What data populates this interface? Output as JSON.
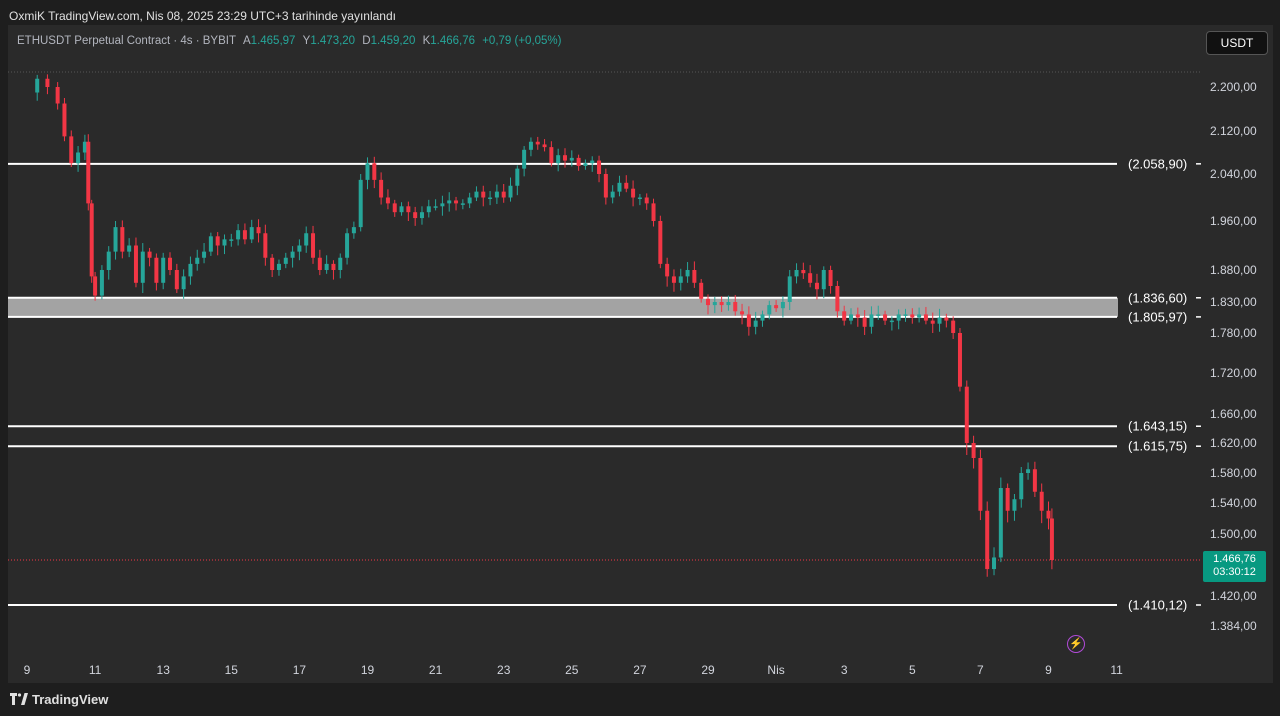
{
  "header": {
    "title": "OxmiK TradingView.com, Nis 08, 2025 23:29 UTC+3 tarihinde yayınlandı"
  },
  "symbol_bar": {
    "name": "ETHUSDT Perpetual Contract · 4s · BYBIT",
    "open_label": "A",
    "open": "1.465,97",
    "high_label": "Y",
    "high": "1.473,20",
    "low_label": "D",
    "low": "1.459,20",
    "close_label": "K",
    "close": "1.466,76",
    "change": "+0,79 (+0,05%)"
  },
  "currency_button": "USDT",
  "last_price": {
    "value": "1.466,76",
    "countdown": "03:30:12",
    "raw": 1466.76
  },
  "footer": {
    "logo_text": "TradingView"
  },
  "icons": {
    "bolt": "lightning-bolt-icon",
    "logo": "tradingview-logo-icon"
  },
  "colors": {
    "up": "#26a69a",
    "down": "#f23645",
    "background": "#2a2a2a",
    "level": "#ffffff",
    "zone": "#b2b2b2",
    "tag": "#089981"
  },
  "chart_data": {
    "type": "candlestick",
    "title": "ETHUSDT Perpetual Contract · 4s · BYBIT",
    "x_ticks": [
      "9",
      "11",
      "13",
      "15",
      "17",
      "19",
      "21",
      "23",
      "25",
      "27",
      "29",
      "Nis",
      "3",
      "5",
      "7",
      "9",
      "11"
    ],
    "y_ticks": [
      {
        "value": 2200,
        "label": "2.200,00"
      },
      {
        "value": 2120,
        "label": "2.120,00"
      },
      {
        "value": 2040,
        "label": "2.040,00"
      },
      {
        "value": 1960,
        "label": "1.960,00"
      },
      {
        "value": 1880,
        "label": "1.880,00"
      },
      {
        "value": 1830,
        "label": "1.830,00"
      },
      {
        "value": 1780,
        "label": "1.780,00"
      },
      {
        "value": 1720,
        "label": "1.720,00"
      },
      {
        "value": 1660,
        "label": "1.660,00"
      },
      {
        "value": 1620,
        "label": "1.620,00"
      },
      {
        "value": 1580,
        "label": "1.580,00"
      },
      {
        "value": 1540,
        "label": "1.540,00"
      },
      {
        "value": 1500,
        "label": "1.500,00"
      },
      {
        "value": 1420,
        "label": "1.420,00"
      },
      {
        "value": 1384,
        "label": "1.384,00"
      }
    ],
    "levels": [
      {
        "value": 2058.9,
        "label": "(2.058,90)"
      },
      {
        "value": 1836.6,
        "label": "(1.836,60)"
      },
      {
        "value": 1805.97,
        "label": "(1.805,97)"
      },
      {
        "value": 1643.15,
        "label": "(1.643,15)"
      },
      {
        "value": 1615.75,
        "label": "(1.615,75)"
      },
      {
        "value": 1410.12,
        "label": "(1.410,12)"
      }
    ],
    "zone": {
      "low": 1805.97,
      "high": 1836.6
    },
    "series_close": [
      [
        9.0,
        2190
      ],
      [
        9.3,
        2215
      ],
      [
        9.6,
        2200
      ],
      [
        9.9,
        2170
      ],
      [
        10.1,
        2110
      ],
      [
        10.3,
        2060
      ],
      [
        10.5,
        2080
      ],
      [
        10.7,
        2100
      ],
      [
        10.8,
        1990
      ],
      [
        10.9,
        1870
      ],
      [
        11.0,
        1840
      ],
      [
        11.2,
        1880
      ],
      [
        11.4,
        1910
      ],
      [
        11.6,
        1950
      ],
      [
        11.8,
        1910
      ],
      [
        12.0,
        1920
      ],
      [
        12.2,
        1860
      ],
      [
        12.4,
        1910
      ],
      [
        12.6,
        1900
      ],
      [
        12.8,
        1860
      ],
      [
        13.0,
        1900
      ],
      [
        13.2,
        1880
      ],
      [
        13.4,
        1850
      ],
      [
        13.6,
        1870
      ],
      [
        13.8,
        1890
      ],
      [
        14.0,
        1900
      ],
      [
        14.2,
        1910
      ],
      [
        14.4,
        1935
      ],
      [
        14.6,
        1920
      ],
      [
        14.8,
        1930
      ],
      [
        15.0,
        1930
      ],
      [
        15.2,
        1945
      ],
      [
        15.4,
        1930
      ],
      [
        15.6,
        1950
      ],
      [
        15.8,
        1940
      ],
      [
        16.0,
        1900
      ],
      [
        16.2,
        1880
      ],
      [
        16.4,
        1890
      ],
      [
        16.6,
        1900
      ],
      [
        16.8,
        1910
      ],
      [
        17.0,
        1920
      ],
      [
        17.2,
        1940
      ],
      [
        17.4,
        1900
      ],
      [
        17.6,
        1880
      ],
      [
        17.8,
        1890
      ],
      [
        18.0,
        1880
      ],
      [
        18.2,
        1900
      ],
      [
        18.4,
        1940
      ],
      [
        18.6,
        1950
      ],
      [
        18.8,
        2030
      ],
      [
        19.0,
        2060
      ],
      [
        19.2,
        2030
      ],
      [
        19.4,
        2000
      ],
      [
        19.6,
        1990
      ],
      [
        19.8,
        1975
      ],
      [
        20.0,
        1985
      ],
      [
        20.2,
        1975
      ],
      [
        20.4,
        1965
      ],
      [
        20.6,
        1975
      ],
      [
        20.8,
        1985
      ],
      [
        21.0,
        1985
      ],
      [
        21.2,
        1990
      ],
      [
        21.4,
        1995
      ],
      [
        21.6,
        1990
      ],
      [
        21.8,
        1990
      ],
      [
        22.0,
        2000
      ],
      [
        22.2,
        2010
      ],
      [
        22.4,
        2000
      ],
      [
        22.6,
        2000
      ],
      [
        22.8,
        2010
      ],
      [
        23.0,
        2000
      ],
      [
        23.2,
        2020
      ],
      [
        23.4,
        2050
      ],
      [
        23.6,
        2085
      ],
      [
        23.8,
        2100
      ],
      [
        24.0,
        2095
      ],
      [
        24.2,
        2090
      ],
      [
        24.4,
        2060
      ],
      [
        24.6,
        2075
      ],
      [
        24.8,
        2065
      ],
      [
        25.0,
        2070
      ],
      [
        25.2,
        2055
      ],
      [
        25.4,
        2060
      ],
      [
        25.6,
        2065
      ],
      [
        25.8,
        2040
      ],
      [
        26.0,
        2000
      ],
      [
        26.2,
        2010
      ],
      [
        26.4,
        2025
      ],
      [
        26.6,
        2015
      ],
      [
        26.8,
        2000
      ],
      [
        27.0,
        2000
      ],
      [
        27.2,
        1990
      ],
      [
        27.4,
        1960
      ],
      [
        27.6,
        1890
      ],
      [
        27.8,
        1870
      ],
      [
        28.0,
        1860
      ],
      [
        28.2,
        1870
      ],
      [
        28.4,
        1880
      ],
      [
        28.6,
        1860
      ],
      [
        28.8,
        1835
      ],
      [
        29.0,
        1825
      ],
      [
        29.2,
        1830
      ],
      [
        29.4,
        1825
      ],
      [
        29.6,
        1830
      ],
      [
        29.8,
        1815
      ],
      [
        30.0,
        1810
      ],
      [
        30.2,
        1790
      ],
      [
        30.4,
        1800
      ],
      [
        30.6,
        1810
      ],
      [
        30.8,
        1825
      ],
      [
        31.0,
        1820
      ],
      [
        31.2,
        1830
      ],
      [
        31.4,
        1870
      ],
      [
        31.6,
        1880
      ],
      [
        31.8,
        1875
      ],
      [
        32.0,
        1860
      ],
      [
        32.2,
        1850
      ],
      [
        32.4,
        1880
      ],
      [
        32.6,
        1855
      ],
      [
        32.8,
        1815
      ],
      [
        33.0,
        1800
      ],
      [
        33.2,
        1810
      ],
      [
        33.4,
        1805
      ],
      [
        33.6,
        1790
      ],
      [
        33.8,
        1810
      ],
      [
        34.0,
        1810
      ],
      [
        34.2,
        1800
      ],
      [
        34.4,
        1800
      ],
      [
        34.6,
        1810
      ],
      [
        34.8,
        1810
      ],
      [
        35.0,
        1805
      ],
      [
        35.2,
        1810
      ],
      [
        35.4,
        1800
      ],
      [
        35.6,
        1795
      ],
      [
        35.8,
        1805
      ],
      [
        36.0,
        1800
      ],
      [
        36.2,
        1780
      ],
      [
        36.4,
        1700
      ],
      [
        36.6,
        1620
      ],
      [
        36.8,
        1600
      ],
      [
        37.0,
        1530
      ],
      [
        37.2,
        1455
      ],
      [
        37.4,
        1470
      ],
      [
        37.6,
        1560
      ],
      [
        37.8,
        1530
      ],
      [
        38.0,
        1545
      ],
      [
        38.2,
        1580
      ],
      [
        38.4,
        1585
      ],
      [
        38.6,
        1555
      ],
      [
        38.8,
        1530
      ],
      [
        39.0,
        1520
      ],
      [
        39.1,
        1466.76
      ]
    ]
  }
}
